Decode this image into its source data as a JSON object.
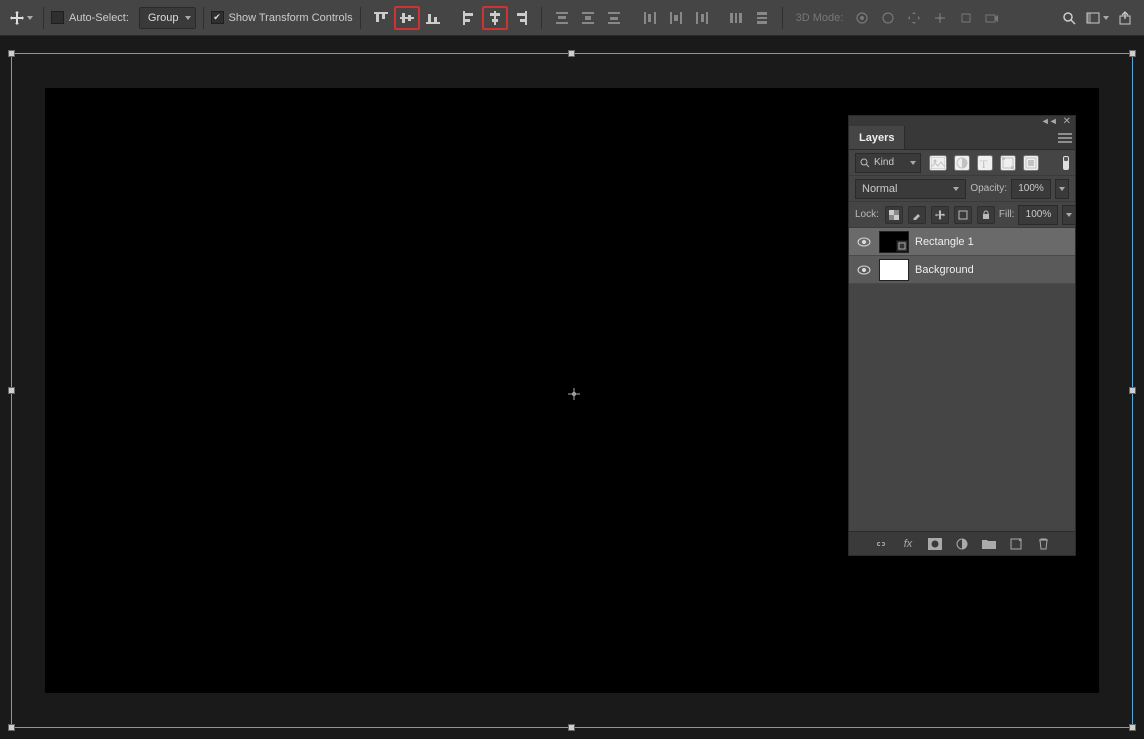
{
  "options_bar": {
    "auto_select_label": "Auto-Select:",
    "auto_select_checked": false,
    "target_dropdown": "Group",
    "show_transform_label": "Show Transform Controls",
    "show_transform_checked": true,
    "three_d_label": "3D Mode:"
  },
  "layers_panel": {
    "tab_label": "Layers",
    "filter_kind_label": "Kind",
    "blend_mode": "Normal",
    "opacity_label": "Opacity:",
    "opacity_value": "100%",
    "lock_label": "Lock:",
    "fill_label": "Fill:",
    "fill_value": "100%",
    "layers": [
      {
        "name": "Rectangle 1",
        "selected": true,
        "visible": true,
        "thumb": "black-shape"
      },
      {
        "name": "Background",
        "selected": false,
        "visible": true,
        "thumb": "white"
      }
    ]
  }
}
